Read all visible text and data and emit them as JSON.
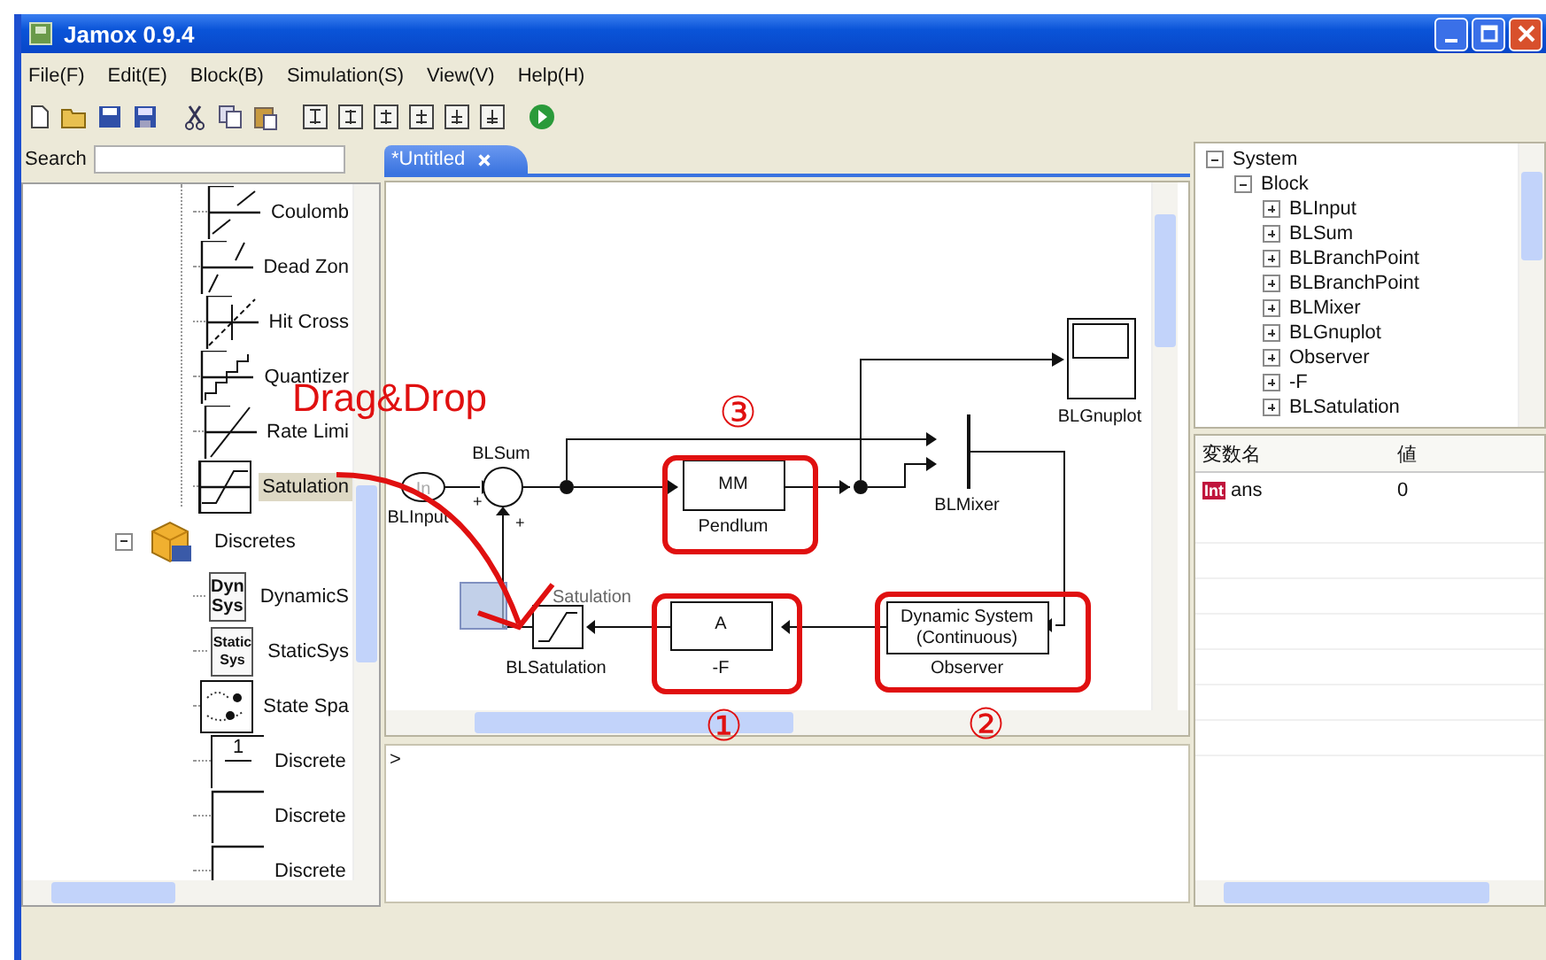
{
  "window": {
    "title": "Jamox 0.9.4"
  },
  "menu": [
    "File(F)",
    "Edit(E)",
    "Block(B)",
    "Simulation(S)",
    "View(V)",
    "Help(H)"
  ],
  "search": {
    "label": "Search"
  },
  "library": [
    {
      "label": "Coulomb",
      "kind": "coulomb",
      "selected": false
    },
    {
      "label": "Dead Zon",
      "kind": "deadzone",
      "selected": false
    },
    {
      "label": "Hit Cross",
      "kind": "hitcross",
      "selected": false
    },
    {
      "label": "Quantizer",
      "kind": "quantizer",
      "selected": false
    },
    {
      "label": "Rate Limi",
      "kind": "ratelimit",
      "selected": false
    },
    {
      "label": "Satulation",
      "kind": "saturation",
      "selected": true
    },
    {
      "label": "Discretes",
      "kind": "folder",
      "expanded": true,
      "selected": false,
      "children": [
        {
          "label": "DynamicS",
          "kind": "textbox",
          "icon_text": [
            "Dyn",
            "Sys"
          ],
          "selected": false
        },
        {
          "label": "StaticSys",
          "kind": "textboxsmall",
          "icon_text": [
            "Static",
            "Sys"
          ],
          "selected": false
        },
        {
          "label": "State Spa",
          "kind": "statespace",
          "selected": false
        },
        {
          "label": "Discrete",
          "kind": "fraction",
          "icon_text": [
            "1"
          ],
          "selected": false
        },
        {
          "label": "Discrete",
          "kind": "blank",
          "selected": false
        },
        {
          "label": "Discrete",
          "kind": "blank",
          "selected": false
        }
      ]
    }
  ],
  "tabs": [
    {
      "label": "*Untitled",
      "selected": true
    }
  ],
  "diagram": {
    "input": {
      "name": "BLInput",
      "symbol": "In"
    },
    "sum": {
      "name": "BLSum",
      "signs": [
        "+",
        "+"
      ]
    },
    "pendulum": {
      "name": "Pendlum",
      "text": "MM"
    },
    "mixer": {
      "name": "BLMixer"
    },
    "gnuplot": {
      "name": "BLGnuplot"
    },
    "observer": {
      "name": "Observer",
      "text": [
        "Dynamic System",
        "(Continuous)"
      ]
    },
    "gain": {
      "name": "-F",
      "text": "A"
    },
    "saturation": {
      "name": "BLSatulation"
    },
    "drag_preview": {
      "name": "Satulation"
    }
  },
  "annotations": {
    "drag_label": "Drag&Drop",
    "markers": [
      "①",
      "②",
      "③"
    ]
  },
  "console": {
    "prompt": ">"
  },
  "object_tree": [
    {
      "label": "System",
      "expanded": true,
      "children": [
        {
          "label": "Block",
          "expanded": true,
          "children": [
            {
              "label": "BLInput",
              "expanded": false
            },
            {
              "label": "BLSum",
              "expanded": false
            },
            {
              "label": "BLBranchPoint",
              "expanded": false
            },
            {
              "label": "BLBranchPoint",
              "expanded": false
            },
            {
              "label": "BLMixer",
              "expanded": false
            },
            {
              "label": "BLGnuplot",
              "expanded": false
            },
            {
              "label": "Observer",
              "expanded": false
            },
            {
              "label": "-F",
              "expanded": false
            },
            {
              "label": "BLSatulation",
              "expanded": false
            }
          ]
        }
      ]
    }
  ],
  "variables": {
    "columns": [
      "変数名",
      "値"
    ],
    "rows": [
      {
        "type": "Int",
        "name": "ans",
        "value": "0"
      }
    ]
  }
}
